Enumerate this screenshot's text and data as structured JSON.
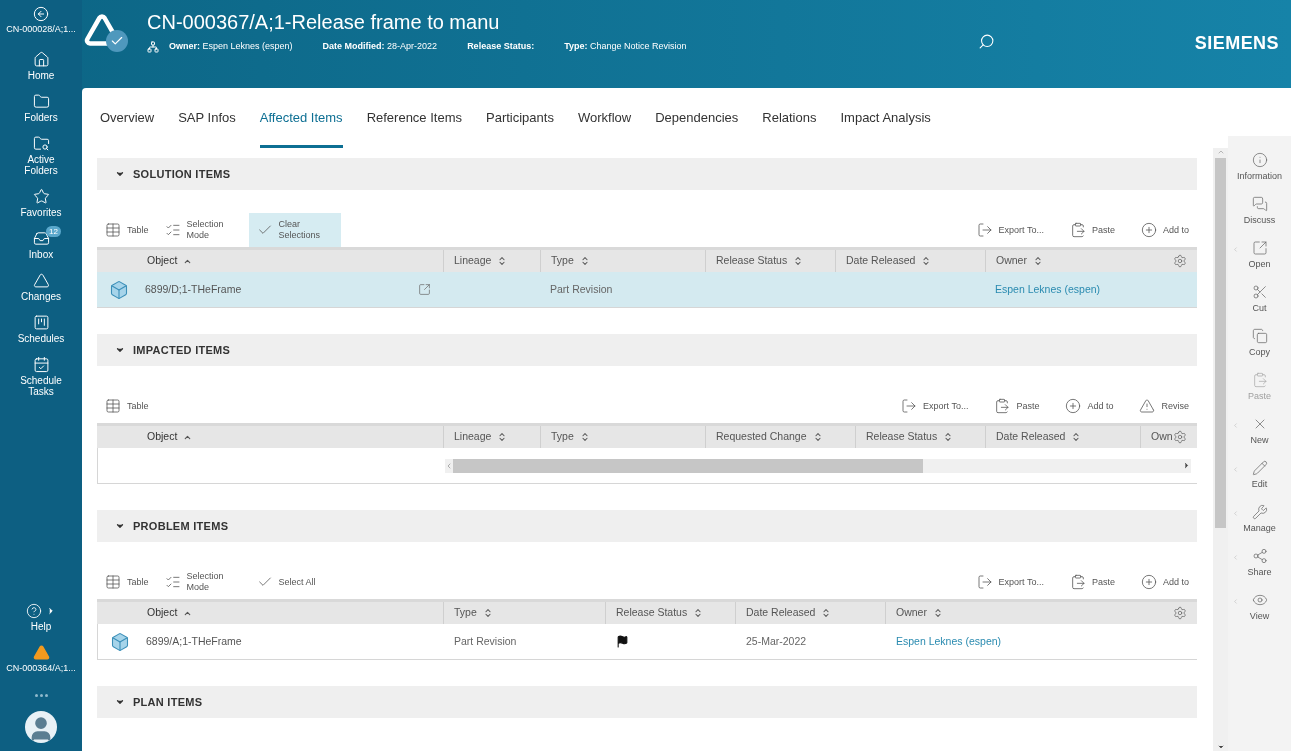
{
  "nav": {
    "back": "CN-000028/A;1...",
    "items": [
      {
        "label": "Home",
        "kind": "home"
      },
      {
        "label": "Folders",
        "kind": "folder"
      },
      {
        "label": "Active Folders",
        "kind": "active"
      },
      {
        "label": "Favorites",
        "kind": "star"
      },
      {
        "label": "Inbox",
        "kind": "inbox",
        "badge": "12"
      },
      {
        "label": "Changes",
        "kind": "changes"
      },
      {
        "label": "Schedules",
        "kind": "schedule"
      },
      {
        "label": "Schedule Tasks",
        "kind": "tasks"
      }
    ],
    "help": "Help",
    "recent": "CN-000364/A;1..."
  },
  "header": {
    "title": "CN-000367/A;1-Release frame to manu",
    "fields": [
      {
        "label": "Owner:",
        "value": "Espen Leknes (espen)"
      },
      {
        "label": "Date Modified:",
        "value": "28-Apr-2022"
      },
      {
        "label": "Release Status:"
      },
      {
        "label": "Type:",
        "value": "Change Notice Revision"
      }
    ],
    "brand": "SIEMENS"
  },
  "tabs": [
    {
      "label": "Overview",
      "selected": false
    },
    {
      "label": "SAP Infos",
      "selected": false
    },
    {
      "label": "Affected Items",
      "selected": true
    },
    {
      "label": "Reference Items",
      "selected": false
    },
    {
      "label": "Participants",
      "selected": false
    },
    {
      "label": "Workflow",
      "selected": false
    },
    {
      "label": "Dependencies",
      "selected": false
    },
    {
      "label": "Relations",
      "selected": false
    },
    {
      "label": "Impact Analysis",
      "selected": false
    }
  ],
  "sections": [
    {
      "title": "SOLUTION ITEMS",
      "expanded": true,
      "toolbar_left": [
        {
          "label": "Table",
          "kind": "table",
          "selected": false
        },
        {
          "label": "Selection Mode",
          "kind": "selection",
          "selected": false
        },
        {
          "label": "Clear Selections",
          "kind": "check",
          "selected": true
        }
      ],
      "toolbar_right": [
        {
          "label": "Export To...",
          "kind": "export"
        },
        {
          "label": "Paste",
          "kind": "paste"
        },
        {
          "label": "Add to",
          "kind": "add"
        }
      ],
      "table": {
        "columns": [
          {
            "label": "Object",
            "sortable": true,
            "sorted": true
          },
          {
            "label": "Lineage",
            "sortable": true,
            "sorted": false
          },
          {
            "label": "Type",
            "sortable": true,
            "sorted": false
          },
          {
            "label": "Release Status",
            "sortable": true,
            "sorted": false
          },
          {
            "label": "Date Released",
            "sortable": true,
            "sorted": false
          },
          {
            "label": "Owner",
            "sortable": true,
            "sorted": false
          }
        ],
        "rows": [
          {
            "selected": true,
            "cells": [
              {
                "kind": "object",
                "text": "6899/D;1-THeFrame",
                "open": true
              },
              {
                "kind": "text"
              },
              {
                "kind": "text",
                "text": "Part Revision"
              },
              {
                "kind": "text"
              },
              {
                "kind": "text"
              },
              {
                "kind": "link",
                "text": "Espen Leknes (espen)"
              }
            ]
          }
        ]
      }
    },
    {
      "title": "IMPACTED ITEMS",
      "expanded": true,
      "toolbar_left": [
        {
          "label": "Table",
          "kind": "table",
          "selected": false
        }
      ],
      "toolbar_right": [
        {
          "label": "Export To...",
          "kind": "export"
        },
        {
          "label": "Paste",
          "kind": "paste"
        },
        {
          "label": "Add to",
          "kind": "add"
        },
        {
          "label": "Revise",
          "kind": "revise"
        }
      ],
      "table": {
        "columns": [
          {
            "label": "Object",
            "sortable": true,
            "sorted": true
          },
          {
            "label": "Lineage",
            "sortable": true,
            "sorted": false
          },
          {
            "label": "Type",
            "sortable": true,
            "sorted": false
          },
          {
            "label": "Requested Change",
            "sortable": true,
            "sorted": false
          },
          {
            "label": "Release Status",
            "sortable": true,
            "sorted": false
          },
          {
            "label": "Date Released",
            "sortable": true,
            "sorted": false
          },
          {
            "label": "Own",
            "sortable": false,
            "sorted": false
          }
        ],
        "horizontal_scrollbar": true
      }
    },
    {
      "title": "PROBLEM ITEMS",
      "expanded": true,
      "toolbar_left": [
        {
          "label": "Table",
          "kind": "table",
          "selected": false
        },
        {
          "label": "Selection Mode",
          "kind": "selection",
          "selected": false
        },
        {
          "label": "Select All",
          "kind": "check",
          "selected": false
        }
      ],
      "toolbar_right": [
        {
          "label": "Export To...",
          "kind": "export"
        },
        {
          "label": "Paste",
          "kind": "paste"
        },
        {
          "label": "Add to",
          "kind": "add"
        }
      ],
      "table": {
        "columns": [
          {
            "label": "Object",
            "sortable": true,
            "sorted": true
          },
          {
            "label": "Type",
            "sortable": true,
            "sorted": false
          },
          {
            "label": "Release Status",
            "sortable": true,
            "sorted": false
          },
          {
            "label": "Date Released",
            "sortable": true,
            "sorted": false
          },
          {
            "label": "Owner",
            "sortable": true,
            "sorted": false
          }
        ],
        "rows": [
          {
            "selected": false,
            "cells": [
              {
                "kind": "object",
                "text": "6899/A;1-THeFrame",
                "open": false
              },
              {
                "kind": "text",
                "text": "Part Revision"
              },
              {
                "kind": "flag"
              },
              {
                "kind": "text",
                "text": "25-Mar-2022"
              },
              {
                "kind": "link",
                "text": "Espen Leknes (espen)"
              }
            ]
          }
        ]
      }
    },
    {
      "title": "PLAN ITEMS",
      "expanded": true
    }
  ],
  "rail": [
    {
      "label": "Information",
      "submenu": false,
      "disabled": false
    },
    {
      "label": "Discuss",
      "submenu": false,
      "disabled": false
    },
    {
      "label": "Open",
      "submenu": true,
      "disabled": false
    },
    {
      "label": "Cut",
      "submenu": false,
      "disabled": false
    },
    {
      "label": "Copy",
      "submenu": false,
      "disabled": false
    },
    {
      "label": "Paste",
      "submenu": false,
      "disabled": true
    },
    {
      "label": "New",
      "submenu": true,
      "disabled": false
    },
    {
      "label": "Edit",
      "submenu": true,
      "disabled": false
    },
    {
      "label": "Manage",
      "submenu": true,
      "disabled": false
    },
    {
      "label": "Share",
      "submenu": true,
      "disabled": false
    },
    {
      "label": "View",
      "submenu": true,
      "disabled": false
    }
  ]
}
